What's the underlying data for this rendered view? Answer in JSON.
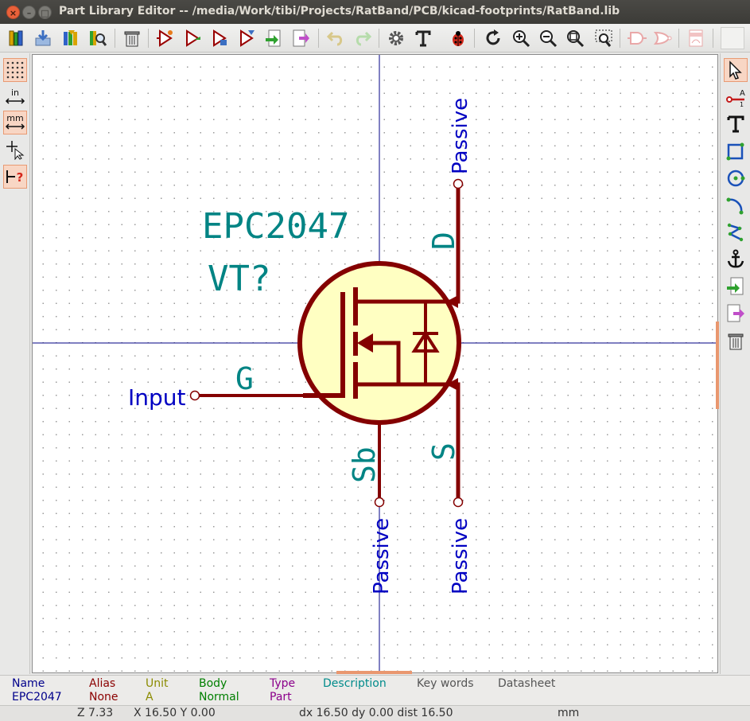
{
  "window": {
    "title": "Part Library Editor -- /media/Work/tibi/Projects/RatBand/PCB/kicad-footprints/RatBand.lib"
  },
  "left_toolbar": {
    "units_in": "in",
    "units_mm": "mm"
  },
  "schematic": {
    "value_field": "EPC2047",
    "reference_field": "VT?",
    "pins": [
      {
        "name": "G",
        "type": "Input"
      },
      {
        "name": "D",
        "type": "Passive"
      },
      {
        "name": "S",
        "type": "Passive"
      },
      {
        "name": "Sb",
        "type": "Passive"
      }
    ],
    "colors": {
      "body_outline": "#840000",
      "body_fill": "#ffffc2",
      "field_text": "#008484",
      "pin_type_text": "#0000c2",
      "axis": "#000084"
    }
  },
  "message_panel": {
    "columns": [
      {
        "header": "Name",
        "value": "EPC2047",
        "header_color": "#00008b",
        "value_color": "#00008b"
      },
      {
        "header": "Alias",
        "value": "None",
        "header_color": "#8b0000",
        "value_color": "#8b0000"
      },
      {
        "header": "Unit",
        "value": "A",
        "header_color": "#8b8b00",
        "value_color": "#8b8b00"
      },
      {
        "header": "Body",
        "value": "Normal",
        "header_color": "#007f00",
        "value_color": "#007f00"
      },
      {
        "header": "Type",
        "value": "Part",
        "header_color": "#8b008b",
        "value_color": "#8b008b"
      },
      {
        "header": "Description",
        "value": "",
        "header_color": "#008b8b",
        "value_color": "#008b8b"
      },
      {
        "header": "Key words",
        "value": "",
        "header_color": "#555555",
        "value_color": "#555555"
      },
      {
        "header": "Datasheet",
        "value": "",
        "header_color": "#555555",
        "value_color": "#555555"
      }
    ]
  },
  "status_bar": {
    "zoom": "Z 7.33",
    "cursor": "X 16.50  Y 0.00",
    "delta": "dx 16.50  dy 0.00  dist 16.50",
    "units": "mm"
  }
}
